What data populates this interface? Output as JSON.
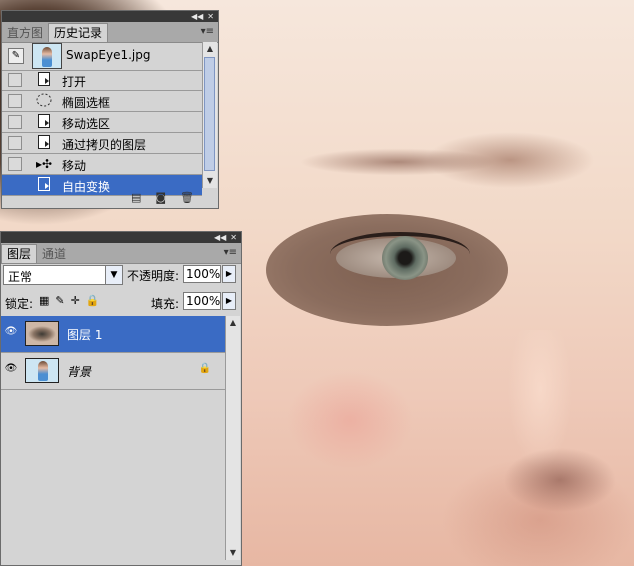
{
  "history_panel": {
    "tabs": [
      "直方图",
      "历史记录"
    ],
    "active_tab": 1,
    "snapshot_name": "SwapEye1.jpg",
    "steps": [
      {
        "label": "打开",
        "icon": "document-icon"
      },
      {
        "label": "椭圆选框",
        "icon": "ellipse-marquee-icon"
      },
      {
        "label": "移动选区",
        "icon": "document-icon"
      },
      {
        "label": "通过拷贝的图层",
        "icon": "document-icon"
      },
      {
        "label": "移动",
        "icon": "move-icon"
      },
      {
        "label": "自由变换",
        "icon": "document-icon"
      }
    ],
    "selected_step": 5
  },
  "layers_panel": {
    "tabs": [
      "图层",
      "通道"
    ],
    "active_tab": 0,
    "blend_mode": "正常",
    "opacity_label": "不透明度:",
    "opacity_value": "100%",
    "lock_label": "锁定:",
    "fill_label": "填充:",
    "fill_value": "100%",
    "layers": [
      {
        "name": "图层 1",
        "selected": true,
        "visible": true,
        "locked": false
      },
      {
        "name": "背景",
        "selected": false,
        "visible": true,
        "locked": true
      }
    ]
  },
  "colors": {
    "selection": "#3a6bc4",
    "panel_bg": "#d4d4d4",
    "titlebar": "#383838"
  }
}
